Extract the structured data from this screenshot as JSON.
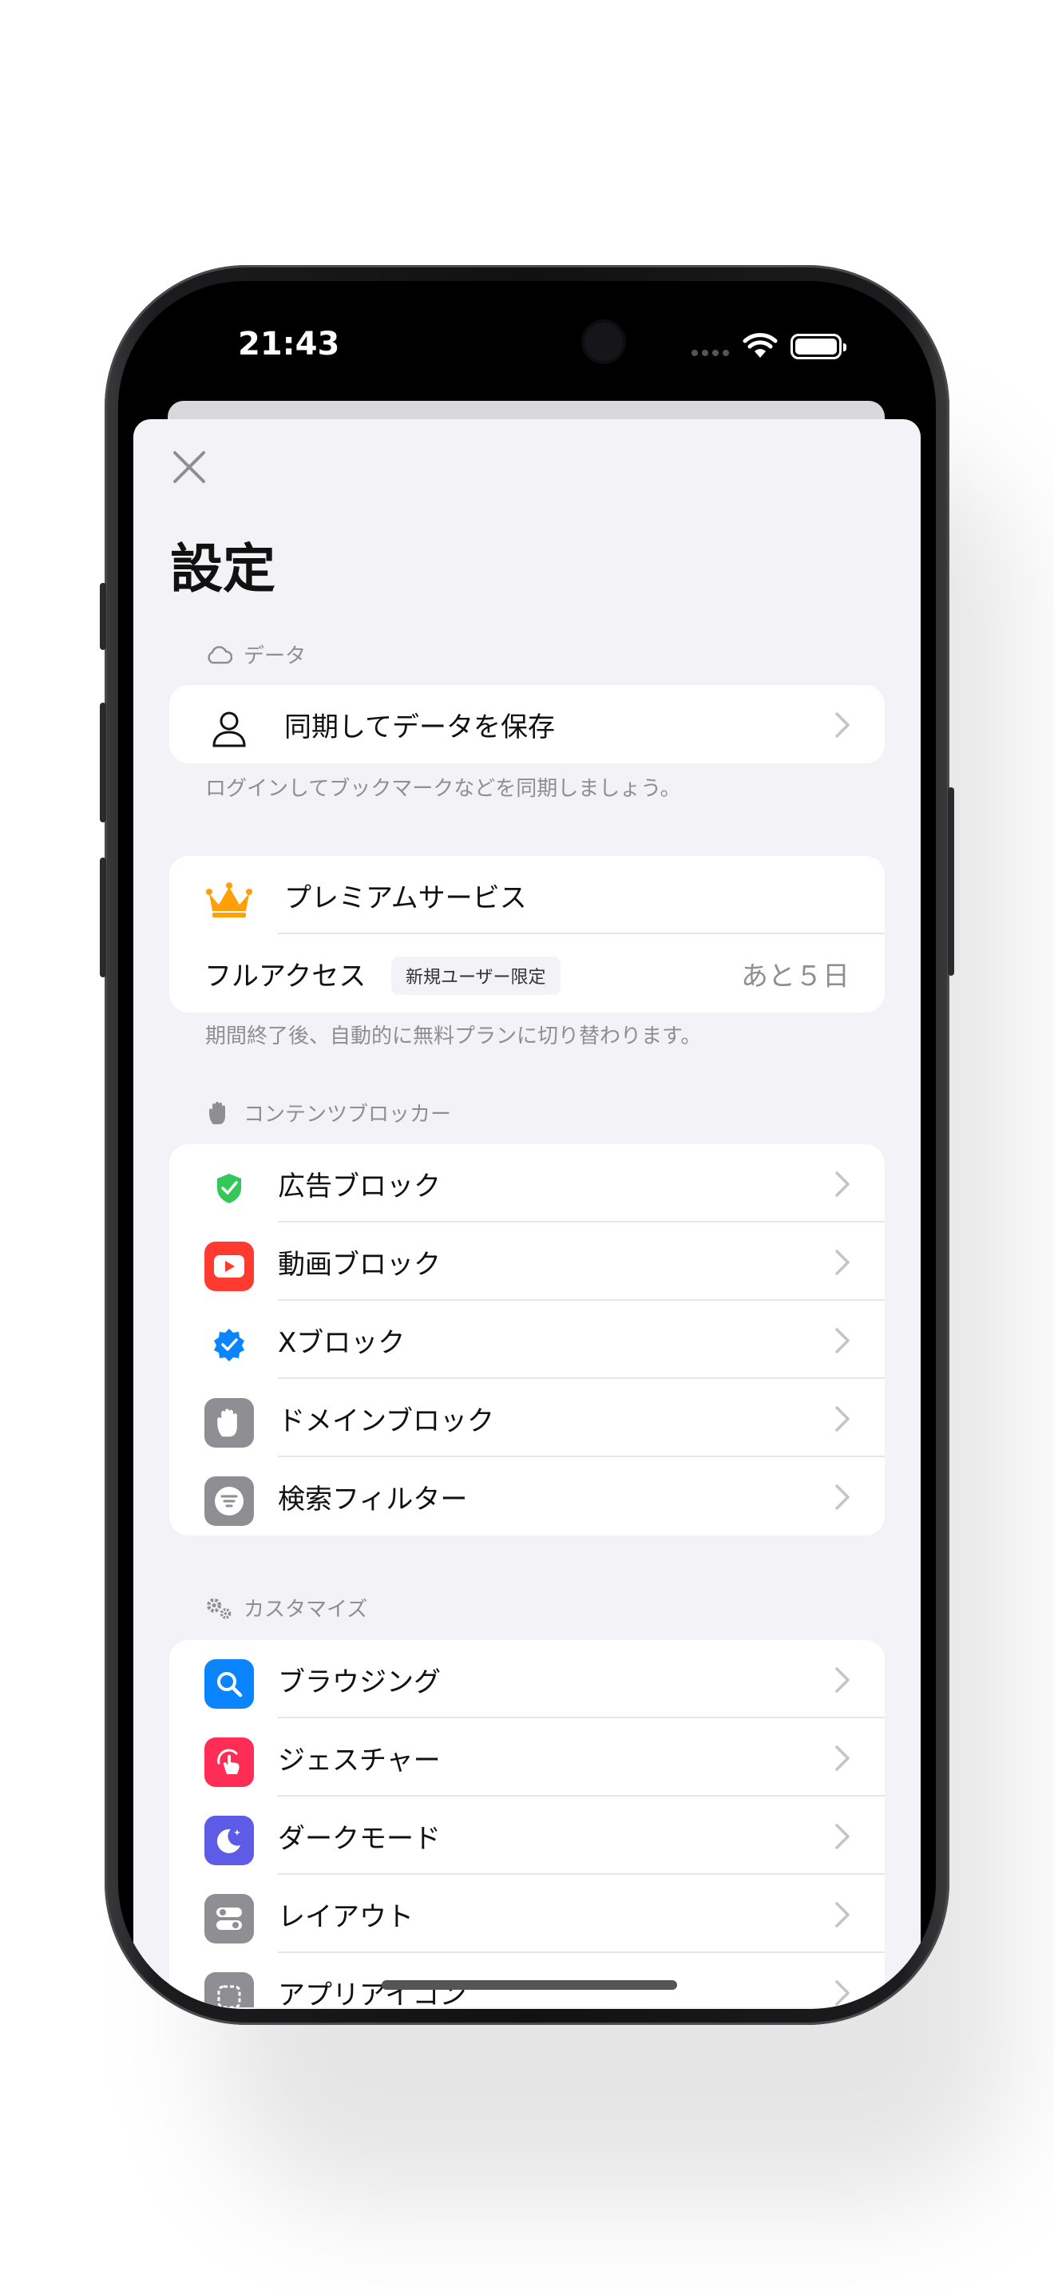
{
  "status_bar": {
    "time": "21:43"
  },
  "sheet": {
    "title": "設定"
  },
  "sections": {
    "data": {
      "header": "データ",
      "items": [
        {
          "label": "同期してデータを保存",
          "icon": "person-icon"
        }
      ],
      "footnote": "ログインしてブックマークなどを同期しましょう。"
    },
    "premium": {
      "label": "プレミアムサービス",
      "icon": "crown-icon",
      "access_label": "フルアクセス",
      "badge": "新規ユーザー限定",
      "remaining": "あと５日",
      "footnote": "期間終了後、自動的に無料プランに切り替わります。"
    },
    "blocker": {
      "header": "コンテンツブロッカー",
      "items": [
        {
          "label": "広告ブロック",
          "icon": "shield-check-icon",
          "color": "#34c759"
        },
        {
          "label": "動画ブロック",
          "icon": "play-icon",
          "color": "#ff3b30"
        },
        {
          "label": "Xブロック",
          "icon": "verified-badge-icon",
          "color": "#0a84ff"
        },
        {
          "label": "ドメインブロック",
          "icon": "hand-icon",
          "color": "#8e8e93"
        },
        {
          "label": "検索フィルター",
          "icon": "filter-icon",
          "color": "#8e8e93"
        }
      ]
    },
    "customize": {
      "header": "カスタマイズ",
      "items": [
        {
          "label": "ブラウジング",
          "icon": "magnifier-icon",
          "color": "#0a84ff"
        },
        {
          "label": "ジェスチャー",
          "icon": "gesture-icon",
          "color": "#ff2d55"
        },
        {
          "label": "ダークモード",
          "icon": "moon-icon",
          "color": "#5e5ce6"
        },
        {
          "label": "レイアウト",
          "icon": "toggles-icon",
          "color": "#8e8e93"
        },
        {
          "label": "アプリアイコン",
          "icon": "app-icon-icon",
          "color": "#8e8e93"
        }
      ]
    }
  }
}
